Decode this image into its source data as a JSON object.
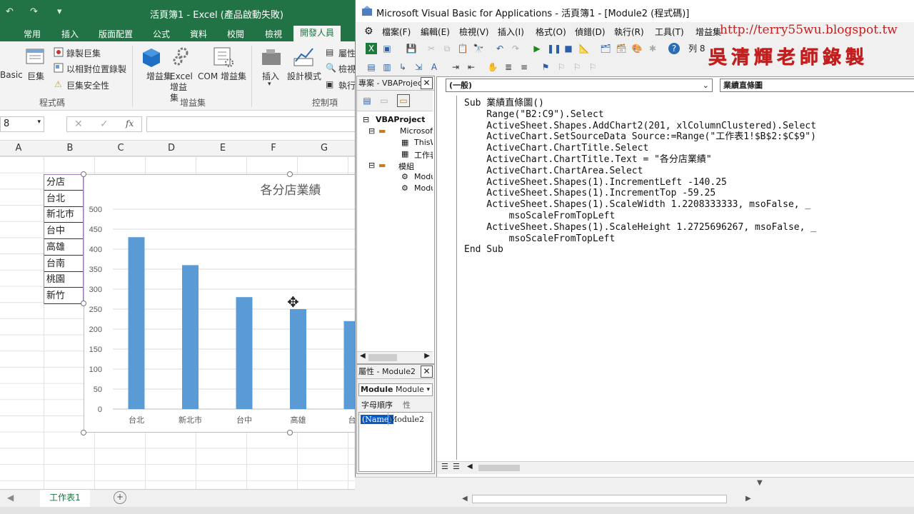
{
  "excel": {
    "title": "活頁簿1 - Excel (產品啟動失敗)",
    "tabs": [
      "常用",
      "插入",
      "版面配置",
      "公式",
      "資料",
      "校閱",
      "檢視",
      "開發人員"
    ],
    "ribbon": {
      "basic_label": "Basic",
      "macros_label": "巨集",
      "record_macro": "錄製巨集",
      "relative_ref": "以相對位置錄製",
      "macro_security": "巨集安全性",
      "group_code": "程式碼",
      "addins_label": "增益集",
      "excel_addins_label": "Excel 增益集",
      "com_addins_label": "COM 增益集",
      "group_addins": "增益集",
      "insert_label": "插入",
      "design_mode_label": "設計模式",
      "properties_label": "屬性",
      "view_code_label": "檢視",
      "run_dialog_label": "執行",
      "group_controls": "控制項"
    },
    "name_box": "8",
    "column_headers": [
      "A",
      "B",
      "C",
      "D",
      "E",
      "F",
      "G"
    ],
    "cells": [
      "分店",
      "台北",
      "新北市",
      "台中",
      "高雄",
      "台南",
      "桃園",
      "新竹"
    ],
    "sheet_tab": "工作表1",
    "add_sheet": "+"
  },
  "chart_data": {
    "type": "bar",
    "title": "各分店業績",
    "categories": [
      "台北",
      "新北市",
      "台中",
      "高雄",
      "台"
    ],
    "values": [
      430,
      360,
      280,
      250,
      220
    ],
    "ylim": [
      0,
      500
    ],
    "yticks": [
      0,
      50,
      100,
      150,
      200,
      250,
      300,
      350,
      400,
      450,
      500
    ],
    "bar_color": "#5b9bd5",
    "grid": true
  },
  "vba": {
    "title": "Microsoft Visual Basic for Applications - 活頁簿1 - [Module2 (程式碼)]",
    "menu": [
      "檔案(F)",
      "編輯(E)",
      "檢視(V)",
      "插入(I)",
      "格式(O)",
      "偵錯(D)",
      "執行(R)",
      "工具(T)",
      "增益集"
    ],
    "toolbar_position": "列 8",
    "project_pane_title": "專案 - VBAProject",
    "tree": [
      "VBAProject",
      "Microsoft",
      "ThisW",
      "工作表",
      "模組",
      "Modu",
      "Modu"
    ],
    "properties_title": "屬性 - Module2",
    "properties_object": "Module",
    "properties_object_type": "Module",
    "properties_tabs": [
      "字母順序",
      "性"
    ],
    "property_name": "(Name)",
    "property_value": "Module2",
    "combo_object": "(一般)",
    "combo_procedure": "業績直條圖",
    "code": "Sub 業績直條圖()\n    Range(\"B2:C9\").Select\n    ActiveSheet.Shapes.AddChart2(201, xlColumnClustered).Select\n    ActiveChart.SetSourceData Source:=Range(\"工作表1!$B$2:$C$9\")\n    ActiveChart.ChartTitle.Select\n    ActiveChart.ChartTitle.Text = \"各分店業績\"\n    ActiveChart.ChartArea.Select\n    ActiveSheet.Shapes(1).IncrementLeft -140.25\n    ActiveSheet.Shapes(1).IncrementTop -59.25\n    ActiveSheet.Shapes(1).ScaleWidth 1.2208333333, msoFalse, _\n        msoScaleFromTopLeft\n    ActiveSheet.Shapes(1).ScaleHeight 1.2725696267, msoFalse, _\n        msoScaleFromTopLeft\nEnd Sub"
  },
  "watermark": {
    "url": "http://terry55wu.blogspot.tw",
    "text": "吳清輝老師錄製"
  }
}
